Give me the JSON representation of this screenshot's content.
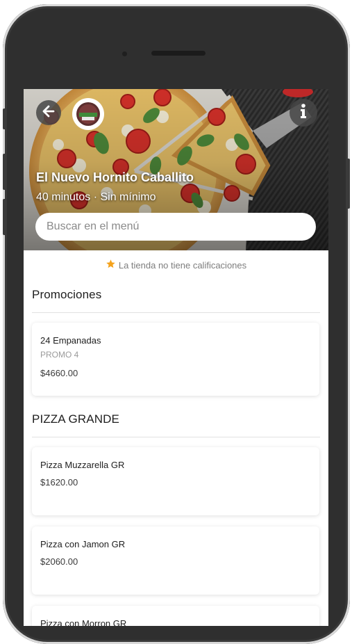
{
  "store": {
    "name": "El Nuevo Hornito Caballito",
    "meta": "40 minutos · Sin mínimo"
  },
  "search": {
    "placeholder": "Buscar en el menú"
  },
  "rating": {
    "text": "La tienda no tiene calificaciones",
    "star_color": "#f4a21c"
  },
  "sections": [
    {
      "title": "Promociones",
      "items": [
        {
          "name": "24 Empanadas",
          "subtitle": "PROMO 4",
          "price": "$4660.00"
        }
      ]
    },
    {
      "title": "PIZZA GRANDE",
      "items": [
        {
          "name": "Pizza Muzzarella GR",
          "price": "$1620.00"
        },
        {
          "name": "Pizza con Jamon GR",
          "price": "$2060.00"
        },
        {
          "name": "Pizza con Morron GR"
        }
      ]
    }
  ],
  "icons": {
    "back": "arrow-left-icon",
    "info": "info-icon",
    "star": "star-icon"
  }
}
